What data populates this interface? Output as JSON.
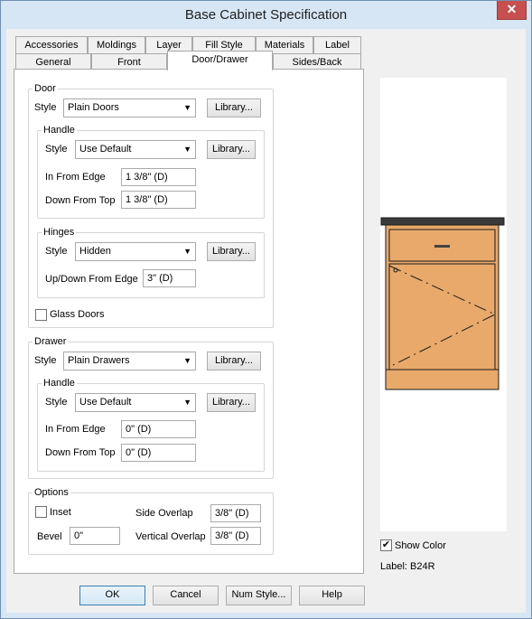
{
  "window": {
    "title": "Base Cabinet Specification",
    "close_glyph": "✕"
  },
  "tabs": {
    "row1": [
      "Accessories",
      "Moldings",
      "Layer",
      "Fill Style",
      "Materials",
      "Label"
    ],
    "row2": [
      "General",
      "Front",
      "Door/Drawer",
      "Sides/Back"
    ],
    "active": "Door/Drawer"
  },
  "door": {
    "group_label": "Door",
    "style_label": "Style",
    "style_value": "Plain Doors",
    "library_label": "Library...",
    "handle": {
      "group_label": "Handle",
      "style_label": "Style",
      "style_value": "Use Default",
      "library_label": "Library...",
      "in_from_edge_label": "In From Edge",
      "in_from_edge_value": "1 3/8\" (D)",
      "down_from_top_label": "Down From Top",
      "down_from_top_value": "1 3/8\" (D)"
    },
    "hinges": {
      "group_label": "Hinges",
      "style_label": "Style",
      "style_value": "Hidden",
      "library_label": "Library...",
      "updown_label": "Up/Down From Edge",
      "updown_value": "3\" (D)"
    },
    "glass_doors_label": "Glass Doors",
    "glass_doors_checked": false
  },
  "drawer": {
    "group_label": "Drawer",
    "style_label": "Style",
    "style_value": "Plain Drawers",
    "library_label": "Library...",
    "handle": {
      "group_label": "Handle",
      "style_label": "Style",
      "style_value": "Use Default",
      "library_label": "Library...",
      "in_from_edge_label": "In From Edge",
      "in_from_edge_value": "0\" (D)",
      "down_from_top_label": "Down From Top",
      "down_from_top_value": "0\" (D)"
    }
  },
  "options": {
    "group_label": "Options",
    "inset_label": "Inset",
    "inset_checked": false,
    "side_overlap_label": "Side Overlap",
    "side_overlap_value": "3/8\" (D)",
    "bevel_label": "Bevel",
    "bevel_value": "0\"",
    "vertical_overlap_label": "Vertical Overlap",
    "vertical_overlap_value": "3/8\" (D)"
  },
  "preview": {
    "show_color_label": "Show Color",
    "show_color_checked": true,
    "check_glyph": "✔",
    "label_text": "Label:  B24R",
    "colors": {
      "cabinet": "#e8a96b",
      "outline": "#1a1a1a",
      "countertop": "#3a3a3a"
    }
  },
  "buttons": {
    "ok": "OK",
    "cancel": "Cancel",
    "num_style": "Num Style...",
    "help": "Help"
  },
  "dropdown_arrow": "▼"
}
